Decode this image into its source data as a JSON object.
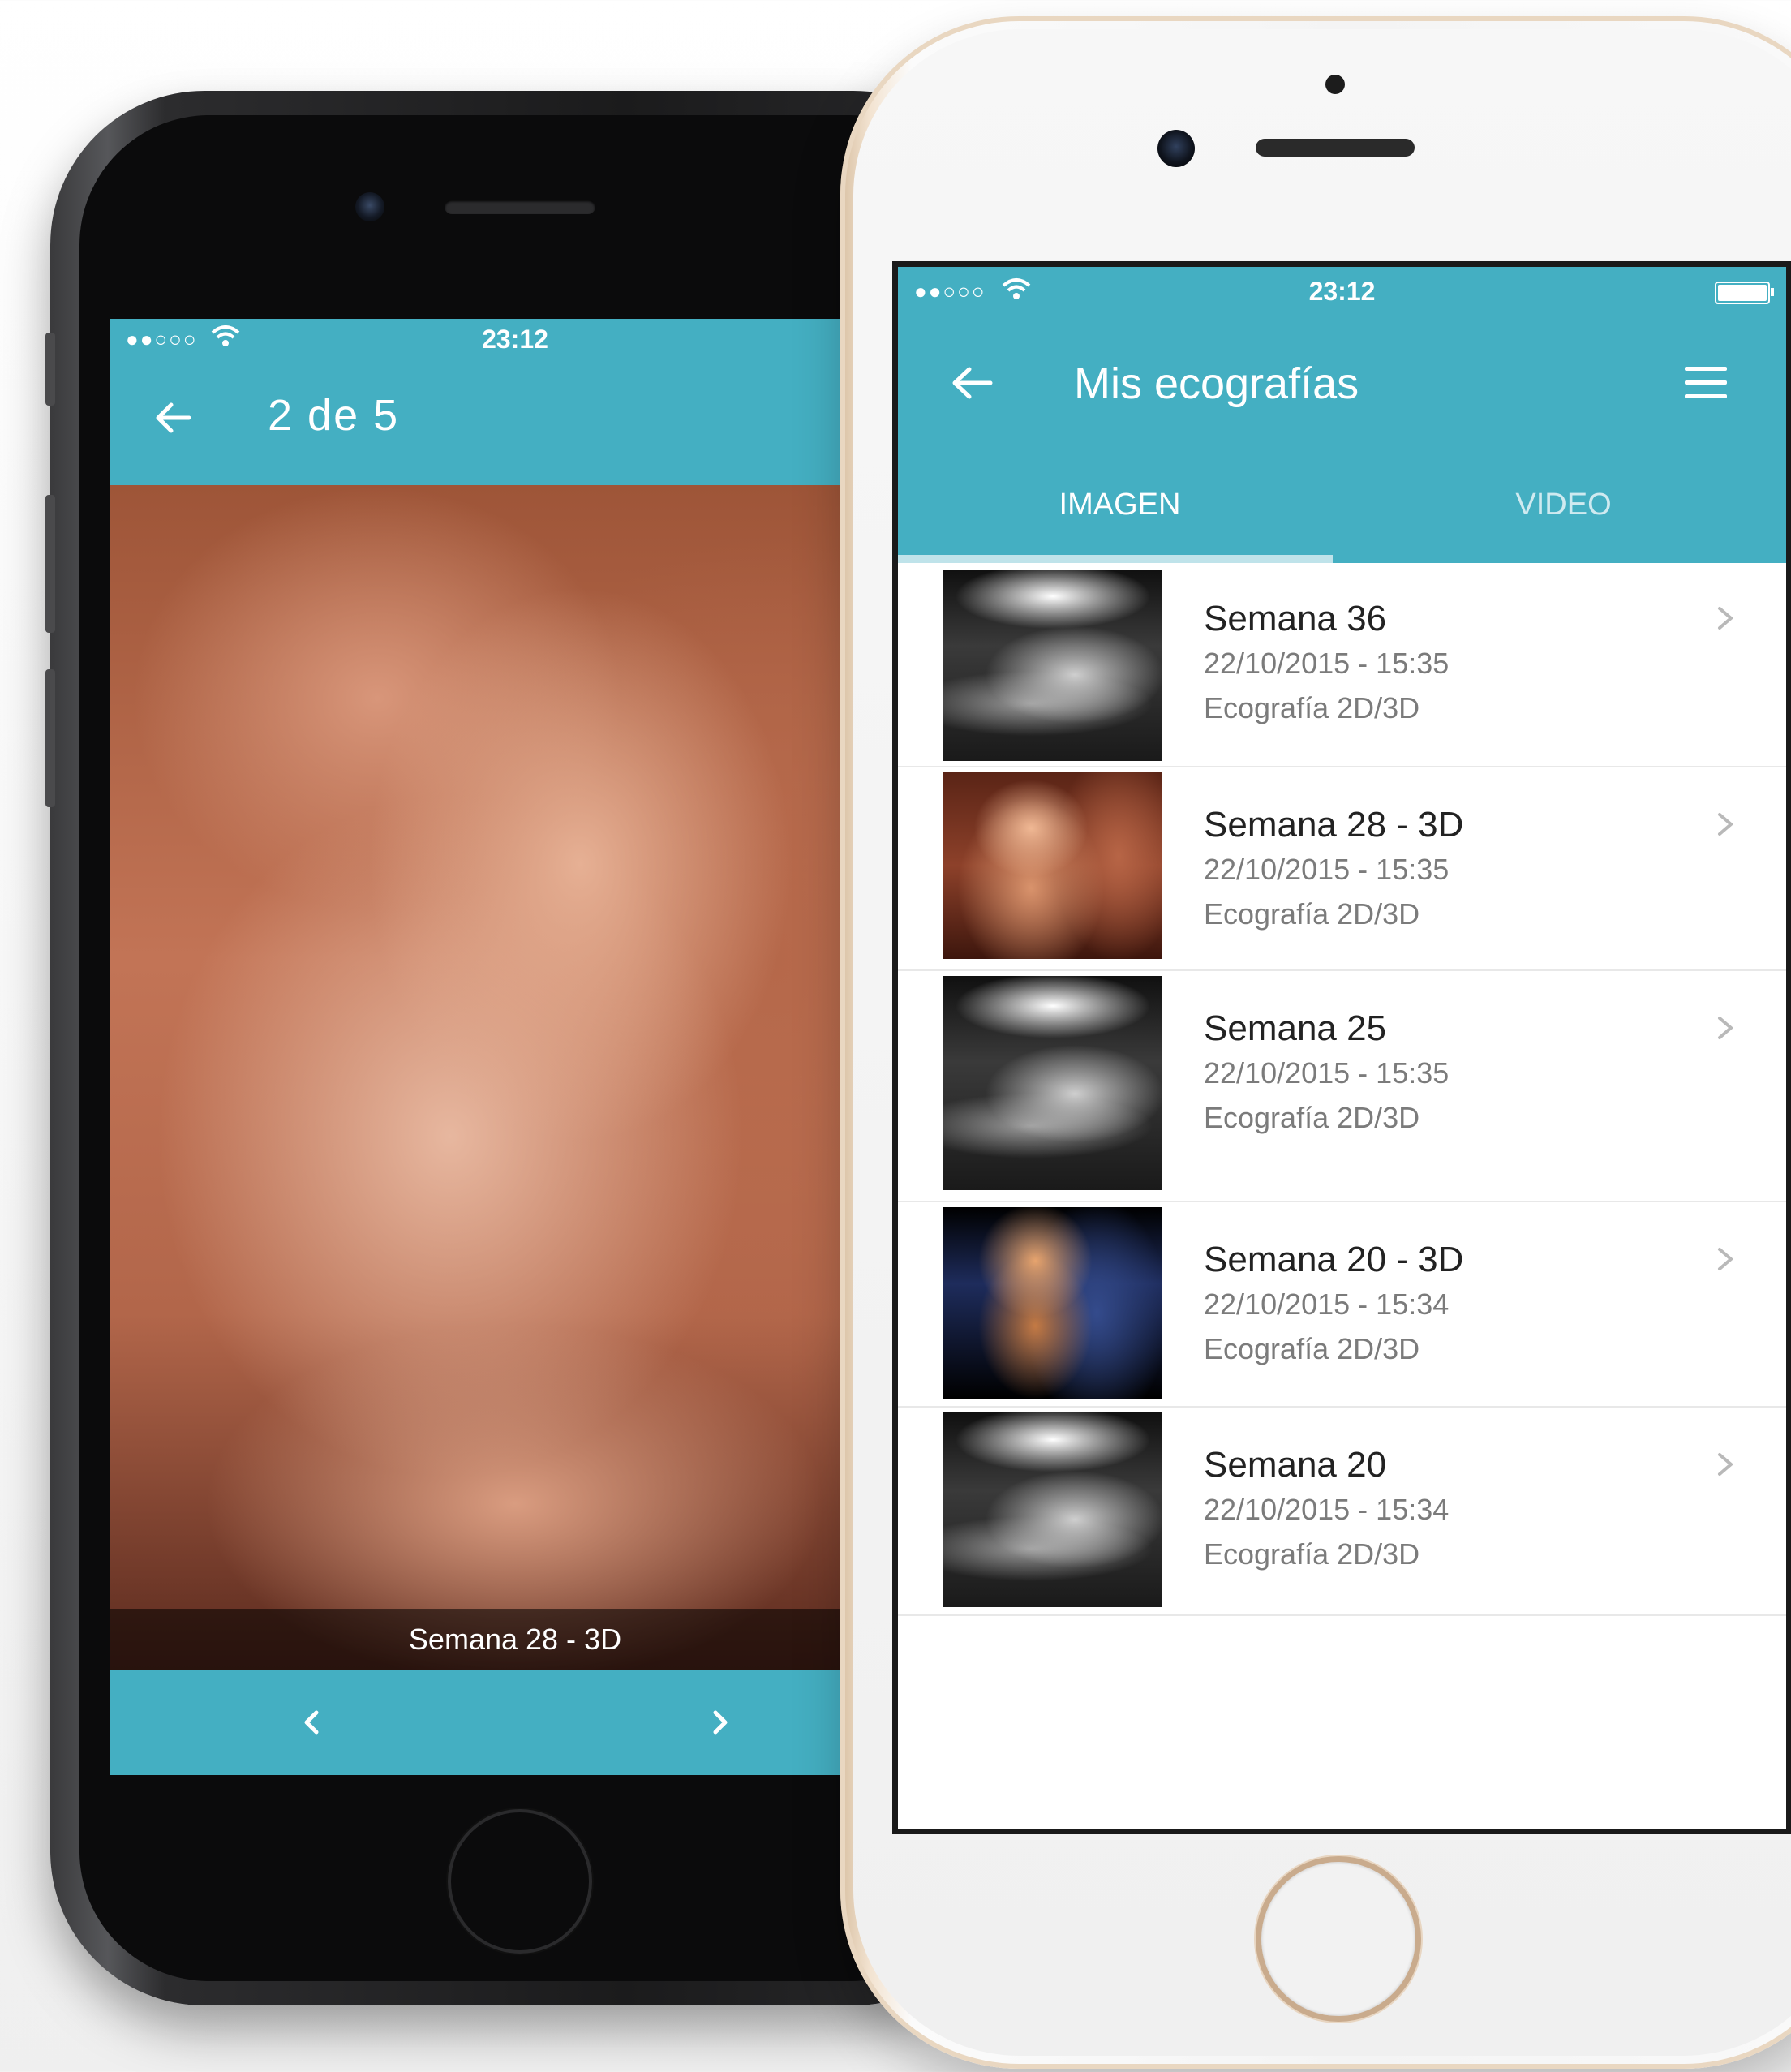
{
  "left_phone": {
    "status_bar": {
      "signal": "●●○○○",
      "time": "23:12"
    },
    "header": {
      "back_icon": "arrow-left-icon",
      "title": "2 de 5"
    },
    "photo_caption": "Semana 28 - 3D",
    "pager": {
      "prev_icon": "chevron-left-icon",
      "next_icon": "chevron-right-icon"
    }
  },
  "right_phone": {
    "status_bar": {
      "signal": "●●○○○",
      "time": "23:12"
    },
    "header": {
      "back_icon": "arrow-left-icon",
      "title": "Mis ecografías",
      "menu_icon": "hamburger-menu-icon"
    },
    "tabs": [
      {
        "label": "IMAGEN",
        "active": true
      },
      {
        "label": "VIDEO",
        "active": false
      }
    ],
    "items": [
      {
        "title": "Semana 36",
        "datetime": "22/10/2015 - 15:35",
        "type": "Ecografía 2D/3D",
        "thumb": "bw"
      },
      {
        "title": "Semana 28 - 3D",
        "datetime": "22/10/2015 - 15:35",
        "type": "Ecografía 2D/3D",
        "thumb": "color3d"
      },
      {
        "title": "Semana 25",
        "datetime": "22/10/2015 - 15:35",
        "type": "Ecografía 2D/3D",
        "thumb": "bw"
      },
      {
        "title": "Semana 20 - 3D",
        "datetime": "22/10/2015 - 15:34",
        "type": "Ecografía 2D/3D",
        "thumb": "blue3d"
      },
      {
        "title": "Semana 20",
        "datetime": "22/10/2015 - 15:34",
        "type": "Ecografía 2D/3D",
        "thumb": "bw"
      }
    ]
  },
  "colors": {
    "accent": "#44afc2",
    "text_primary": "#222222",
    "text_secondary": "#7b7b7b"
  }
}
